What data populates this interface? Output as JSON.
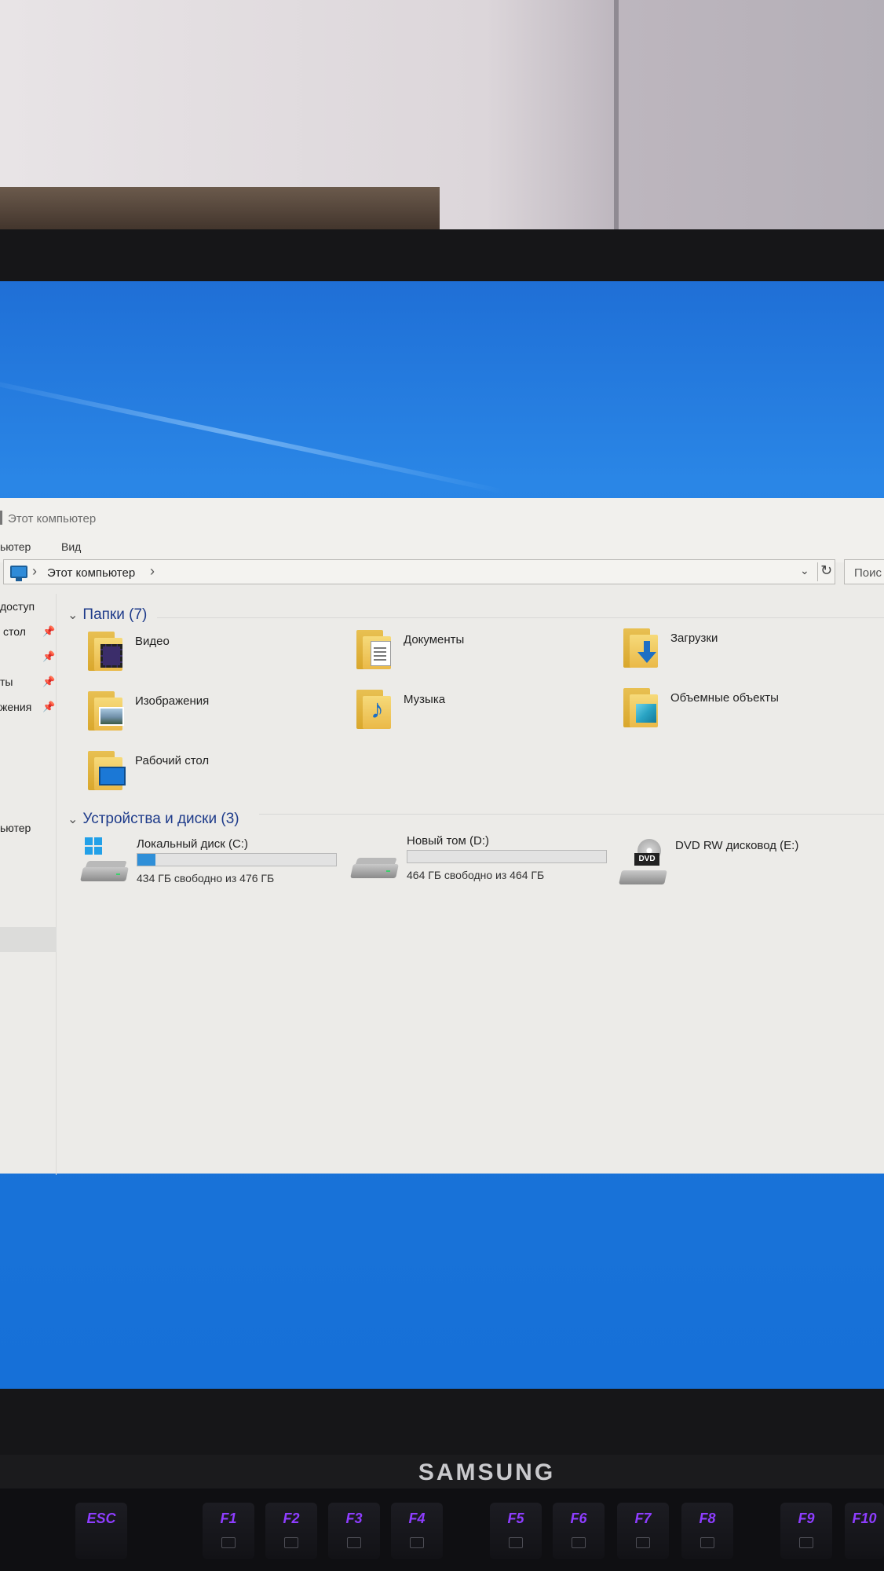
{
  "window": {
    "title": "Этот компьютер",
    "ribbon_tabs": [
      "ьютер",
      "Вид"
    ],
    "address_path": "Этот компьютер",
    "search_placeholder": "Поис"
  },
  "nav_pane": {
    "items": [
      "доступ",
      "стол",
      "ты",
      "жения",
      "ьютер"
    ]
  },
  "folders": {
    "header": "Папки (7)",
    "items": [
      {
        "label": "Видео",
        "icon": "video-folder-icon"
      },
      {
        "label": "Документы",
        "icon": "documents-folder-icon"
      },
      {
        "label": "Загрузки",
        "icon": "downloads-folder-icon"
      },
      {
        "label": "Изображения",
        "icon": "pictures-folder-icon"
      },
      {
        "label": "Музыка",
        "icon": "music-folder-icon"
      },
      {
        "label": "Объемные объекты",
        "icon": "3d-objects-folder-icon"
      },
      {
        "label": "Рабочий стол",
        "icon": "desktop-folder-icon"
      }
    ]
  },
  "drives": {
    "header": "Устройства и диски (3)",
    "items": [
      {
        "name": "Локальный диск (C:)",
        "free": "434 ГБ свободно из 476 ГБ",
        "used_fraction": 0.09
      },
      {
        "name": "Новый том (D:)",
        "free": "464 ГБ свободно из 464 ГБ",
        "used_fraction": 0.0
      },
      {
        "name": "DVD RW дисковод (E:)",
        "badge": "DVD"
      }
    ]
  },
  "monitor": {
    "brand": "SAMSUNG"
  },
  "keyboard": {
    "keys": [
      "ESC",
      "F1",
      "F2",
      "F3",
      "F4",
      "F5",
      "F6",
      "F7",
      "F8",
      "F9",
      "F10"
    ]
  },
  "colors": {
    "desktop_blue": "#1f7be0",
    "drive_bar_fill": "#2f8fd8",
    "group_header": "#1e3b8a",
    "key_backlight": "#8e3dff"
  }
}
